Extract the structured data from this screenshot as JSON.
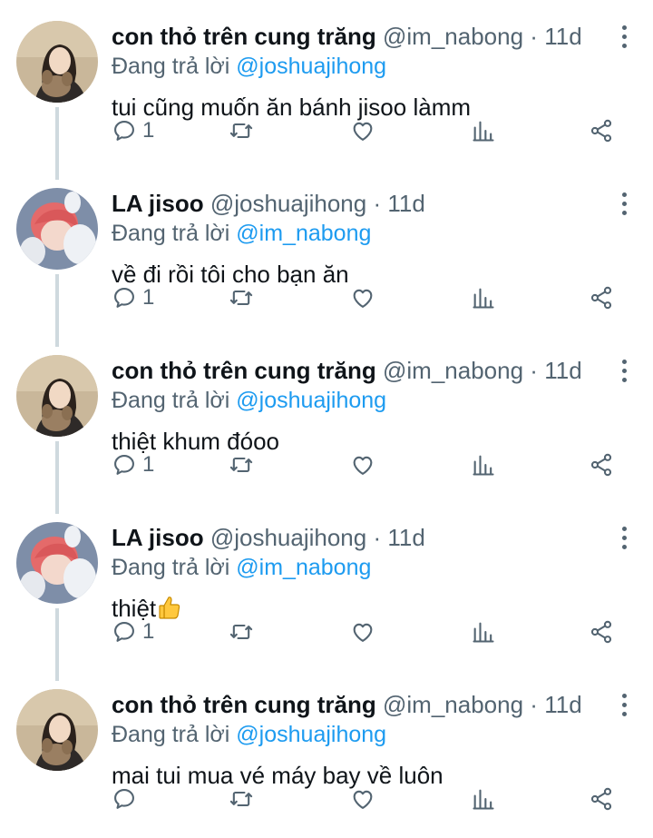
{
  "colors": {
    "mention": "#1d9bf0",
    "secondary": "#536471",
    "thread_line": "#cfd9de"
  },
  "tweets": [
    {
      "name": "con thỏ trên cung trăng",
      "handle": "@im_nabong",
      "sep": "·",
      "time": "11d",
      "reply_prefix": "Đang trả lời",
      "reply_to": "@joshuajihong",
      "text": "tui cũng muốn ăn bánh jisoo làmm",
      "reply_count": "1",
      "avatar": "avatar-girl"
    },
    {
      "name": "LA jisoo",
      "handle": "@joshuajihong",
      "sep": "·",
      "time": "11d",
      "reply_prefix": "Đang trả lời",
      "reply_to": "@im_nabong",
      "text": "về đi rồi tôi cho bạn ăn",
      "reply_count": "1",
      "avatar": "avatar-boy"
    },
    {
      "name": "con thỏ trên cung trăng",
      "handle": "@im_nabong",
      "sep": "·",
      "time": "11d",
      "reply_prefix": "Đang trả lời",
      "reply_to": "@joshuajihong",
      "text": "thiệt khum đóoo",
      "reply_count": "1",
      "avatar": "avatar-girl"
    },
    {
      "name": "LA jisoo",
      "handle": "@joshuajihong",
      "sep": "·",
      "time": "11d",
      "reply_prefix": "Đang trả lời",
      "reply_to": "@im_nabong",
      "text": "thiệt",
      "emoji": "thumbs-up-icon",
      "reply_count": "1",
      "avatar": "avatar-boy"
    },
    {
      "name": "con thỏ trên cung trăng",
      "handle": "@im_nabong",
      "sep": "·",
      "time": "11d",
      "reply_prefix": "Đang trả lời",
      "reply_to": "@joshuajihong",
      "text": "mai tui mua vé máy bay về luôn",
      "reply_count": "",
      "avatar": "avatar-girl"
    }
  ]
}
